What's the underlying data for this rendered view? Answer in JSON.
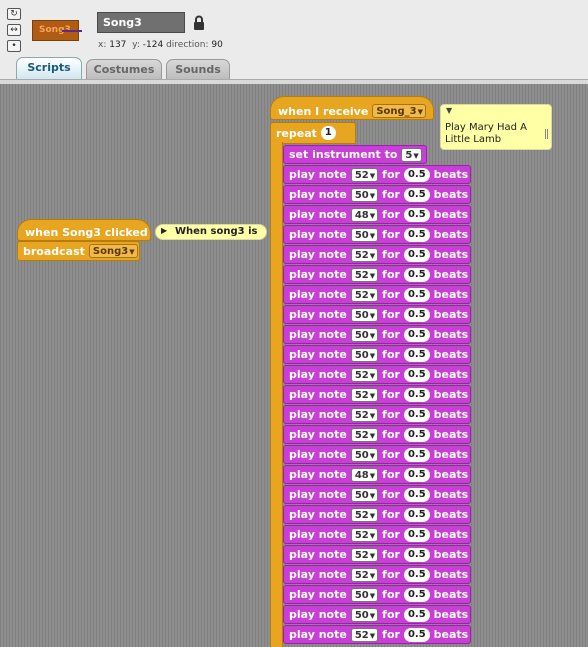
{
  "sprite": {
    "thumbnail_label": "Song3",
    "name": "Song3",
    "x_label": "x:",
    "x_value": "137",
    "y_label": "y:",
    "y_value": "-124",
    "direction_label": "direction:",
    "direction_value": "90"
  },
  "tabs": [
    {
      "label": "Scripts",
      "active": true
    },
    {
      "label": "Costumes",
      "active": false
    },
    {
      "label": "Sounds",
      "active": false
    }
  ],
  "script_left": {
    "hat_label": "when Song3 clicked",
    "broadcast_label": "broadcast",
    "broadcast_value": "Song3",
    "comment": "When song3 is"
  },
  "script_right": {
    "hat_label": "when I receive",
    "hat_value": "Song_3",
    "comment": "Play Mary Had A Little Lamb",
    "repeat_label": "repeat",
    "repeat_count": "1",
    "instrument_label": "set instrument to",
    "instrument_value": "5",
    "play_label": "play note",
    "for_label": "for",
    "beats_label": "beats",
    "notes": [
      {
        "note": "52",
        "beats": "0.5"
      },
      {
        "note": "50",
        "beats": "0.5"
      },
      {
        "note": "48",
        "beats": "0.5"
      },
      {
        "note": "50",
        "beats": "0.5"
      },
      {
        "note": "52",
        "beats": "0.5"
      },
      {
        "note": "52",
        "beats": "0.5"
      },
      {
        "note": "52",
        "beats": "0.5"
      },
      {
        "note": "50",
        "beats": "0.5"
      },
      {
        "note": "50",
        "beats": "0.5"
      },
      {
        "note": "50",
        "beats": "0.5"
      },
      {
        "note": "52",
        "beats": "0.5"
      },
      {
        "note": "52",
        "beats": "0.5"
      },
      {
        "note": "52",
        "beats": "0.5"
      },
      {
        "note": "52",
        "beats": "0.5"
      },
      {
        "note": "50",
        "beats": "0.5"
      },
      {
        "note": "48",
        "beats": "0.5"
      },
      {
        "note": "50",
        "beats": "0.5"
      },
      {
        "note": "52",
        "beats": "0.5"
      },
      {
        "note": "52",
        "beats": "0.5"
      },
      {
        "note": "52",
        "beats": "0.5"
      },
      {
        "note": "52",
        "beats": "0.5"
      },
      {
        "note": "50",
        "beats": "0.5"
      },
      {
        "note": "50",
        "beats": "0.5"
      },
      {
        "note": "52",
        "beats": "0.5"
      }
    ]
  },
  "colors": {
    "control": "#e8a520",
    "sound": "#c83fd6",
    "comment": "#ffffa5",
    "scripts_bg": "#8e8e8e"
  }
}
